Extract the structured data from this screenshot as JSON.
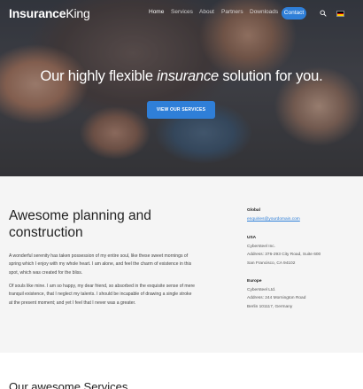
{
  "brand": {
    "name_bold": "Insurance",
    "name_light": "King"
  },
  "nav": {
    "items": [
      "Home",
      "Services",
      "About",
      "Partners",
      "Downloads"
    ],
    "contact_label": "Contact",
    "search_icon": "search-icon",
    "language_flag": "german-flag-icon"
  },
  "hero": {
    "headline_pre": "Our highly flexible ",
    "headline_em": "insurance",
    "headline_post": " solution for you.",
    "button_label": "VIEW OUR SERVICES"
  },
  "about": {
    "title": "Awesome planning and construction",
    "paragraph_1": "A wonderful serenity has taken possession of my entire soul, like these sweet mornings of spring which I enjoy with my whole heart. I am alone, and feel the charm of existence in this spot, which was created for the bliss.",
    "paragraph_2": "Of souls like mine. I am so happy, my dear friend, so absorbed in the exquisite sense of mere tranquil existence, that I neglect my talents. I should be incapable of drawing a single stroke at the present moment; and yet I feel that I never was a greater."
  },
  "contacts": {
    "global": {
      "region": "Global",
      "email": "enquiries@yourdomain.com"
    },
    "usa": {
      "region": "USA",
      "company": "Cybersteel Inc.",
      "address": "Address: 376-293 City Road, Suite 600",
      "city": "San Francisco, CA 94102"
    },
    "europe": {
      "region": "Europe",
      "company": "Cybersteel Ltd.",
      "address": "Address: 244 Mornington Road",
      "city": "Berlin 101117, Germany"
    }
  },
  "services": {
    "title": "Our awesome Services"
  },
  "colors": {
    "accent": "#2f7fd8",
    "section_bg": "#f5f5f5"
  }
}
